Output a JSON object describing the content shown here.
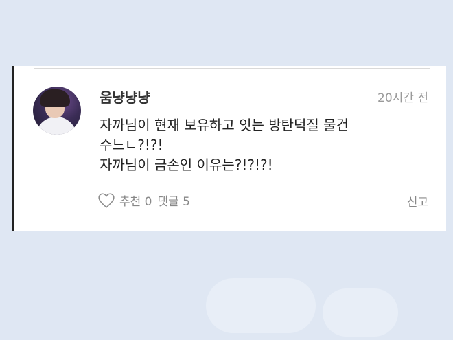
{
  "comment": {
    "username": "움냥냥냥",
    "time": "20시간 전",
    "lines": [
      "자까님이 현재 보유하고 잇는 방탄덕질 물건",
      "수느ㄴ?!?!",
      "자까님이 금손인 이유는?!?!?!"
    ],
    "like_label": "추천 0",
    "reply_label": "댓글 5",
    "report_label": "신고"
  },
  "icons": {
    "like": "heart-outline-icon"
  }
}
